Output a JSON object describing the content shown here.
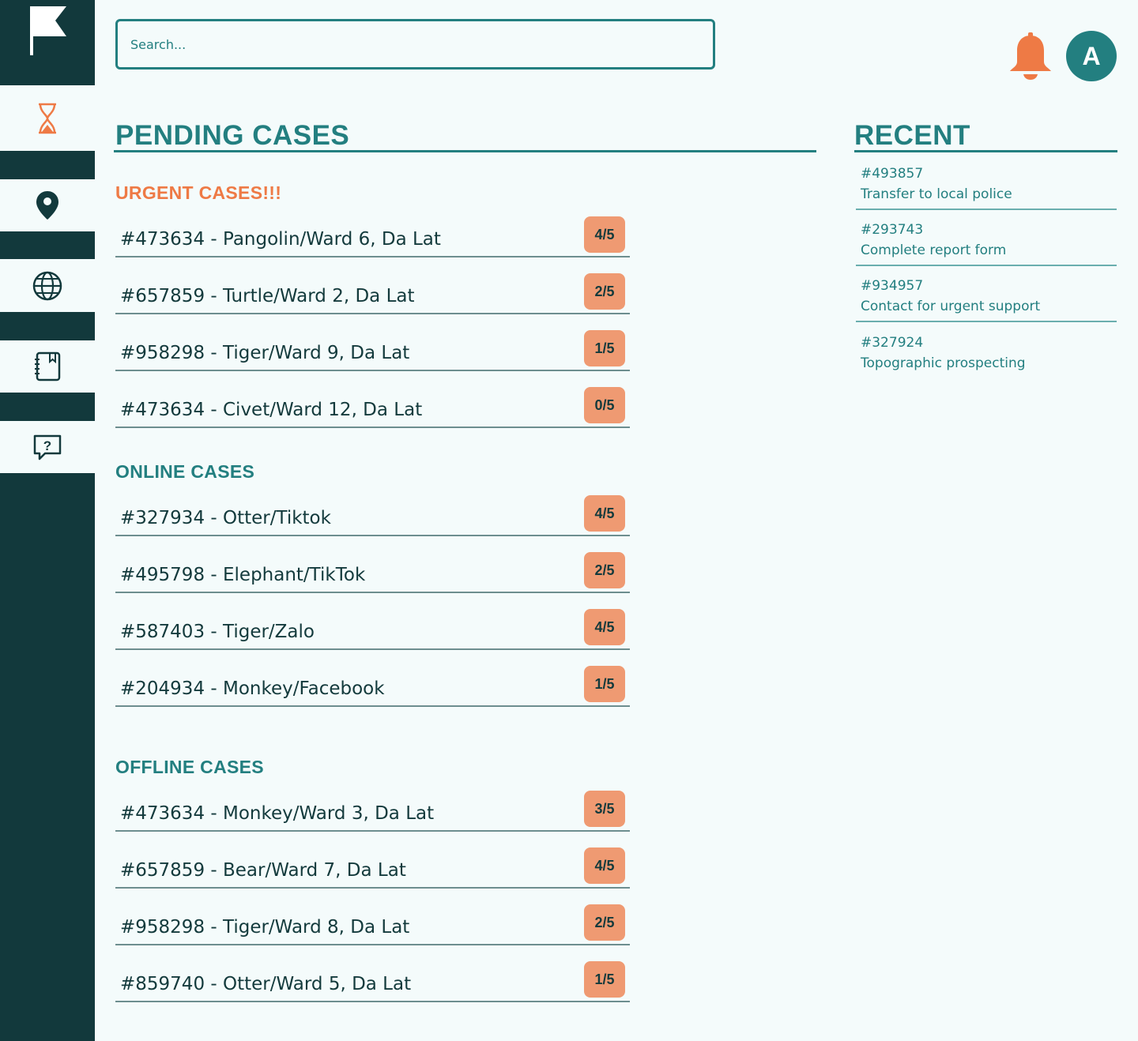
{
  "search": {
    "placeholder": "Search..."
  },
  "user": {
    "avatar_initial": "A"
  },
  "colors": {
    "primary": "#237f80",
    "dark": "#12393c",
    "accent": "#ee7a45",
    "badge": "#ef9a72",
    "background": "#f4fbfb"
  },
  "sidebar": {
    "items": [
      {
        "icon": "hourglass-icon"
      },
      {
        "icon": "map-pin-icon"
      },
      {
        "icon": "globe-icon"
      },
      {
        "icon": "notebook-icon"
      },
      {
        "icon": "help-chat-icon"
      }
    ]
  },
  "pending": {
    "title": "PENDING CASES",
    "groups": [
      {
        "title": "URGENT CASES!!!",
        "cases": [
          {
            "text": "#473634 - Pangolin/Ward 6, Da Lat",
            "progress": "4/5"
          },
          {
            "text": "#657859 - Turtle/Ward 2, Da Lat",
            "progress": "2/5"
          },
          {
            "text": "#958298 - Tiger/Ward 9, Da Lat",
            "progress": "1/5"
          },
          {
            "text": "#473634 - Civet/Ward 12, Da Lat",
            "progress": "0/5"
          }
        ]
      },
      {
        "title": "ONLINE CASES",
        "cases": [
          {
            "text": "#327934 - Otter/Tiktok",
            "progress": "4/5"
          },
          {
            "text": "#495798 - Elephant/TikTok",
            "progress": "2/5"
          },
          {
            "text": "#587403 - Tiger/Zalo",
            "progress": "4/5"
          },
          {
            "text": "#204934 - Monkey/Facebook",
            "progress": "1/5"
          }
        ]
      },
      {
        "title": "OFFLINE CASES",
        "cases": [
          {
            "text": "#473634 - Monkey/Ward 3, Da Lat",
            "progress": "3/5"
          },
          {
            "text": "#657859 - Bear/Ward 7, Da Lat",
            "progress": "4/5"
          },
          {
            "text": "#958298 - Tiger/Ward 8, Da Lat",
            "progress": "2/5"
          },
          {
            "text": "#859740 - Otter/Ward 5, Da Lat",
            "progress": "1/5"
          }
        ]
      }
    ]
  },
  "recent": {
    "title": "RECENT",
    "items": [
      {
        "id": "#493857",
        "desc": "Transfer to local police"
      },
      {
        "id": "#293743",
        "desc": "Complete report form"
      },
      {
        "id": "#934957",
        "desc": "Contact for urgent support"
      },
      {
        "id": "#327924",
        "desc": "Topographic prospecting"
      }
    ]
  }
}
